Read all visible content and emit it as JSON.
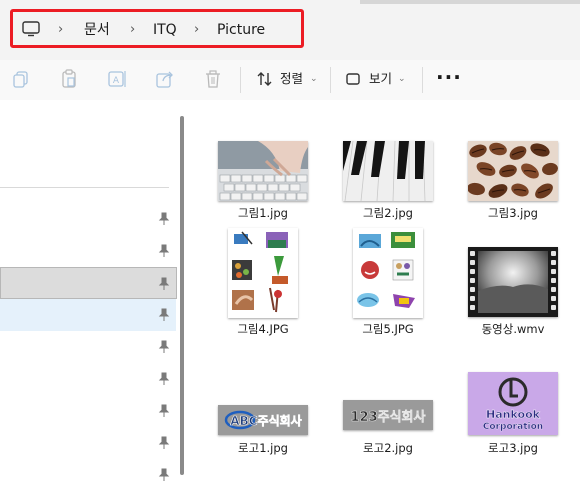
{
  "breadcrumb": {
    "items": [
      "문서",
      "ITQ",
      "Picture"
    ]
  },
  "toolbar": {
    "sort_label": "정렬",
    "view_label": "보기",
    "more_label": "···"
  },
  "files": [
    {
      "name": "그림1.jpg",
      "icon": "keyboard-photo"
    },
    {
      "name": "그림2.jpg",
      "icon": "piano-keys-photo"
    },
    {
      "name": "그림3.jpg",
      "icon": "coffee-beans-photo"
    },
    {
      "name": "그림4.JPG",
      "icon": "clipart-collage"
    },
    {
      "name": "그림5.JPG",
      "icon": "clipart-collage"
    },
    {
      "name": "동영상.wmv",
      "icon": "video-film-thumbnail"
    },
    {
      "name": "로고1.jpg",
      "icon": "abc-logo"
    },
    {
      "name": "로고2.jpg",
      "icon": "123-logo"
    },
    {
      "name": "로고3.jpg",
      "icon": "hankook-logo"
    }
  ],
  "logos": {
    "logo1_text": "ABC주식회사",
    "logo2_text": "123주식회사",
    "logo3_line1": "Hankook",
    "logo3_line2": "Corporation"
  },
  "colors": {
    "highlight": "#ec1c24",
    "selected_row": "#dcdcdc",
    "hover_row": "#e5f1fb",
    "logo3_bg": "#c9a8e8"
  }
}
